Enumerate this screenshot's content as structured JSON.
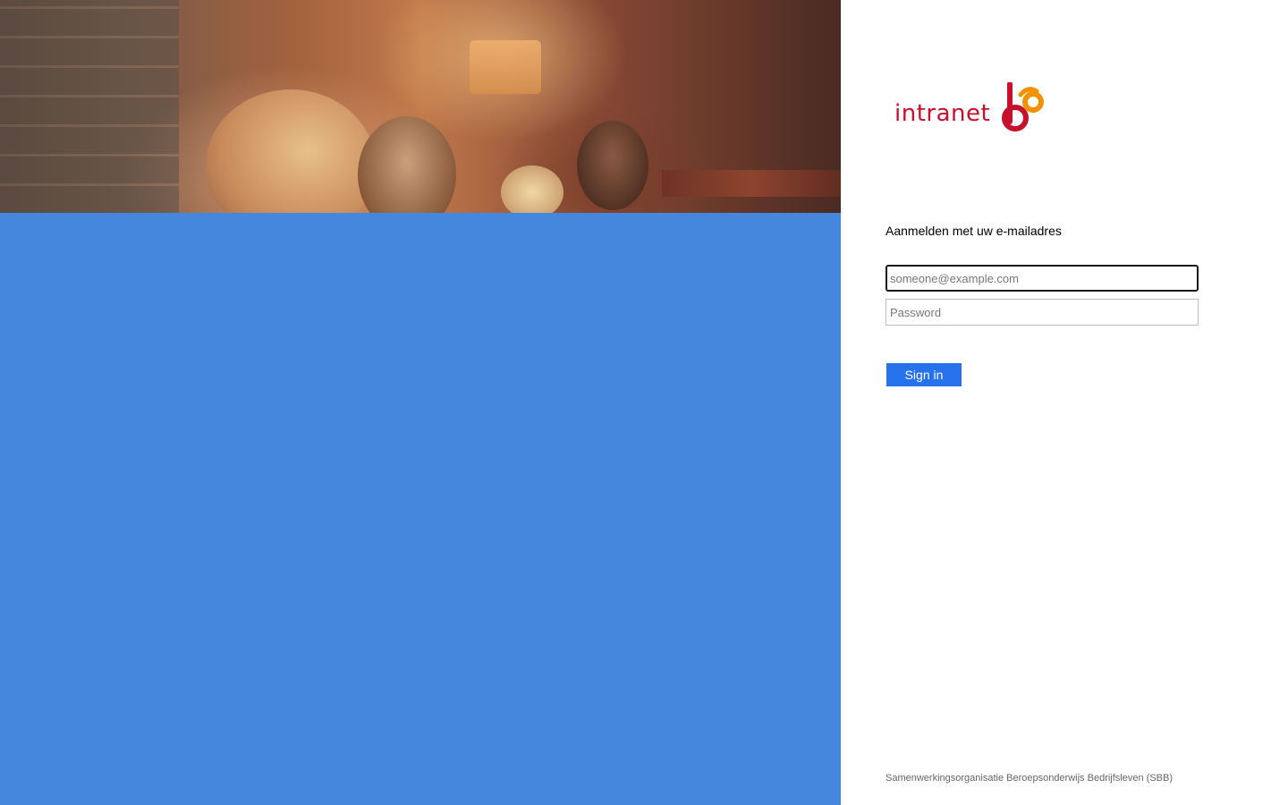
{
  "logo": {
    "text": "intranet",
    "mark": "sbb-logo-mark",
    "colors": {
      "red": "#c8102e",
      "orange": "#f39200"
    }
  },
  "illustration": {
    "background_color": "#4487dd",
    "photo": "bar-scene-photo"
  },
  "form": {
    "title": "Aanmelden met uw e-mailadres",
    "email": {
      "value": "",
      "placeholder": "someone@example.com"
    },
    "password": {
      "value": "",
      "placeholder": "Password"
    },
    "submit_label": "Sign in",
    "accent_color": "#2672ec"
  },
  "footer": {
    "text": "Samenwerkingsorganisatie Beroepsonderwijs Bedrijfsleven (SBB)"
  }
}
